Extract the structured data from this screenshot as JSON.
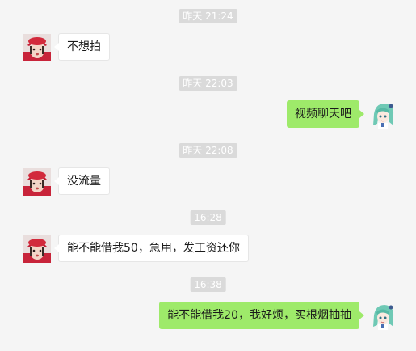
{
  "conversation": {
    "messages": [
      {
        "timestamp": "昨天 21:24",
        "sender": "contact",
        "text": "不想拍"
      },
      {
        "timestamp": "昨天 22:03",
        "sender": "me",
        "text": "视频聊天吧"
      },
      {
        "timestamp": "昨天 22:08",
        "sender": "contact",
        "text": "没流量"
      },
      {
        "timestamp": "16:28",
        "sender": "contact",
        "text": "能不能借我50，急用，发工资还你"
      },
      {
        "timestamp": "16:38",
        "sender": "me",
        "text": "能不能借我20，我好烦，买根烟抽抽"
      }
    ]
  },
  "colors": {
    "background": "#f5f5f5",
    "my_bubble": "#9eea6a",
    "contact_bubble": "#ffffff",
    "timestamp_bg": "#dadada"
  },
  "icons": {
    "contact_avatar": "girl-red-hat-avatar",
    "my_avatar": "anime-green-hair-avatar"
  }
}
